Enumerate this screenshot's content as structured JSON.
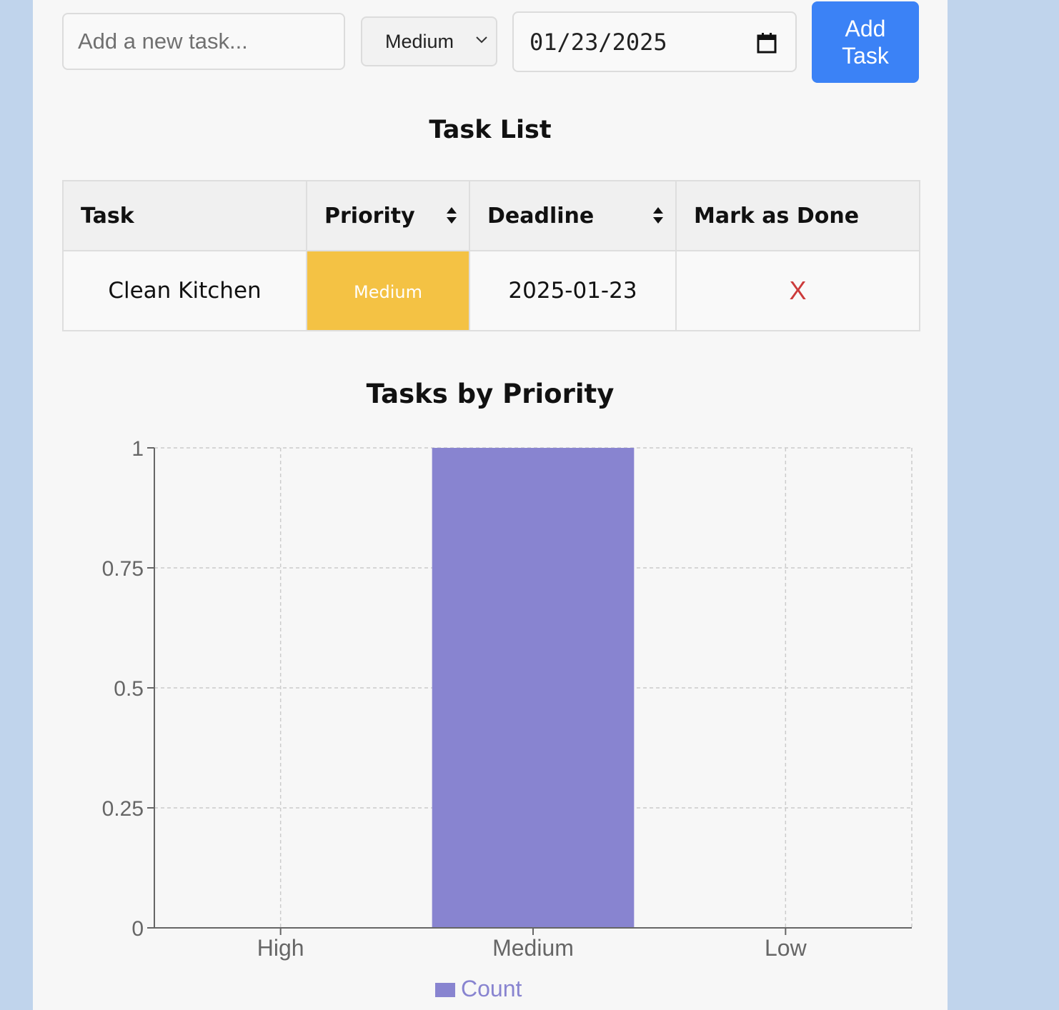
{
  "form": {
    "task_placeholder": "Add a new task...",
    "priority_selected": "Medium",
    "date_value": "01/23/2025",
    "add_button": "Add Task"
  },
  "task_list": {
    "title": "Task List",
    "columns": [
      "Task",
      "Priority",
      "Deadline",
      "Mark as Done"
    ],
    "rows": [
      {
        "task": "Clean Kitchen",
        "priority": "Medium",
        "deadline": "2025-01-23",
        "done_mark": "X"
      }
    ]
  },
  "colors": {
    "medium_priority": "#f4c244",
    "bar": "#8884d0",
    "button": "#3b82f6",
    "delete_x": "#cc3b3b"
  },
  "chart_data": {
    "type": "bar",
    "title": "Tasks by Priority",
    "categories": [
      "High",
      "Medium",
      "Low"
    ],
    "series": [
      {
        "name": "Count",
        "values": [
          0,
          1,
          0
        ]
      }
    ],
    "yticks": [
      "0",
      "0.25",
      "0.5",
      "0.75",
      "1"
    ],
    "ylim": [
      0,
      1
    ],
    "grid": true,
    "legend": "bottom"
  }
}
